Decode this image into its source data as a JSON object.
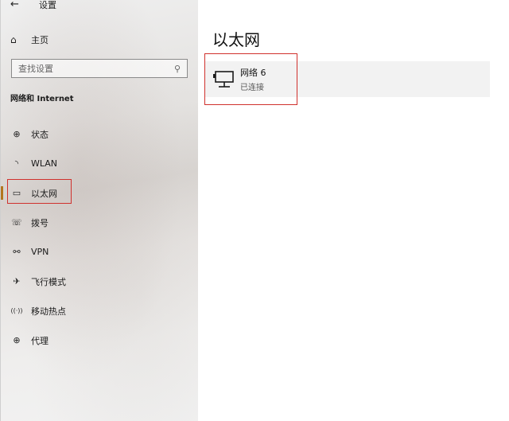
{
  "window": {
    "back_glyph": "←",
    "title": "设置"
  },
  "sidebar": {
    "home": {
      "icon": "home-icon",
      "glyph": "⌂",
      "label": "主页"
    },
    "search": {
      "placeholder": "查找设置",
      "icon": "search-icon",
      "glyph": "⚲"
    },
    "section_title": "网络和 Internet",
    "items": [
      {
        "label": "状态",
        "icon": "network-status-icon",
        "glyph": "⊕",
        "active": false
      },
      {
        "label": "WLAN",
        "icon": "wifi-icon",
        "glyph": "◝",
        "active": false
      },
      {
        "label": "以太网",
        "icon": "ethernet-icon",
        "glyph": "▭",
        "active": true
      },
      {
        "label": "拨号",
        "icon": "dialup-icon",
        "glyph": "☏",
        "active": false
      },
      {
        "label": "VPN",
        "icon": "vpn-icon",
        "glyph": "⚯",
        "active": false
      },
      {
        "label": "飞行模式",
        "icon": "airplane-icon",
        "glyph": "✈",
        "active": false
      },
      {
        "label": "移动热点",
        "icon": "hotspot-icon",
        "glyph": "((·))",
        "active": false
      },
      {
        "label": "代理",
        "icon": "proxy-globe-icon",
        "glyph": "⊕",
        "active": false
      }
    ]
  },
  "main": {
    "title": "以太网",
    "networks": [
      {
        "name": "网络  6",
        "status": "已连接",
        "icon": "ethernet-network-icon"
      }
    ]
  },
  "colors": {
    "accent": "#b2761e",
    "highlight_border": "#d0312d",
    "card_background": "#f2f2f2"
  }
}
